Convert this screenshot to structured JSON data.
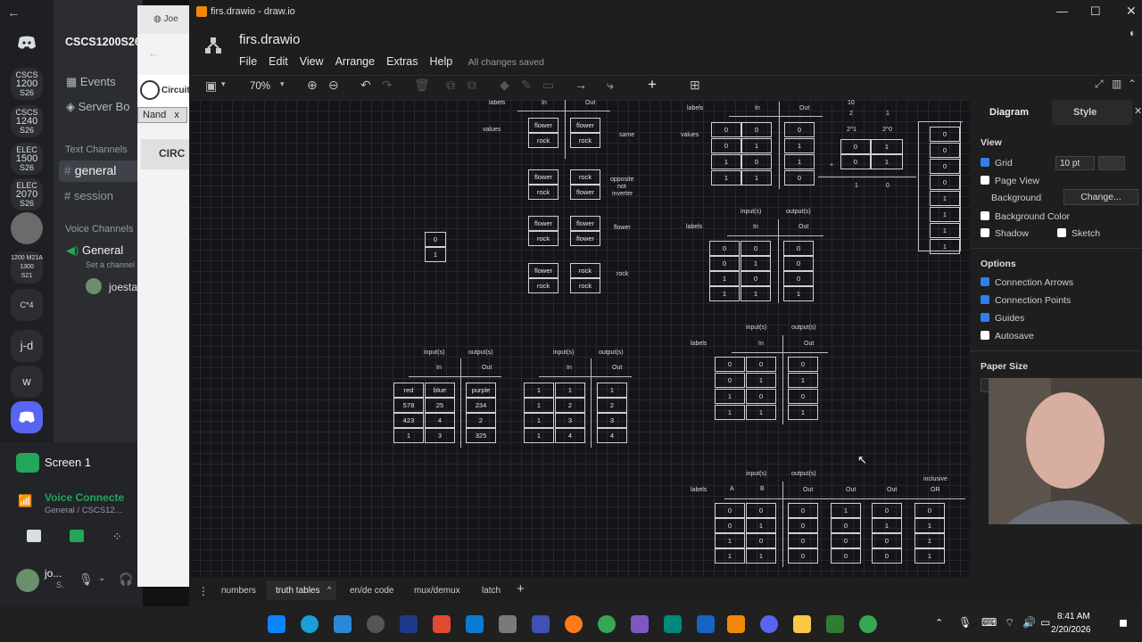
{
  "discord": {
    "nav_back": "←",
    "server_name": "CSCS1200S26",
    "events": "Events",
    "server_boost": "Server Bo",
    "text_channels": "Text Channels",
    "channels": [
      "general",
      "session"
    ],
    "voice_channels": "Voice Channels",
    "voice_general": "General",
    "set_channel": "Set a channel",
    "member": "joesta",
    "servers": [
      {
        "l1": "CSCS",
        "l2": "1200",
        "l3": "S26"
      },
      {
        "l1": "CSCS",
        "l2": "1240",
        "l3": "S26"
      },
      {
        "l1": "ELEC",
        "l2": "1500",
        "l3": "S26"
      },
      {
        "l1": "ELEC",
        "l2": "2070",
        "l3": "S26"
      },
      {
        "l1": "",
        "l2": "",
        "l3": ""
      },
      {
        "l1": "1200 M21A",
        "l2": "1300",
        "l3": "S21"
      },
      {
        "l1": "C*4",
        "l2": "",
        "l3": ""
      },
      {
        "l1": "j-d",
        "l2": "",
        "l3": ""
      },
      {
        "l1": "w",
        "l2": "",
        "l3": ""
      }
    ],
    "screen_share": "Screen 1",
    "voice_connected": "Voice Connecte",
    "voice_sub": "General / CSCS12...",
    "user_short": "jo...",
    "user_sub": "S."
  },
  "browser": {
    "tab": "Joe",
    "site": "Circuit",
    "nand_tag": "Nand",
    "nand_close": "x",
    "circ_label": "CIRC"
  },
  "drawio": {
    "window_title": "firs.drawio - draw.io",
    "file_title": "firs.drawio",
    "menu": [
      "File",
      "Edit",
      "View",
      "Arrange",
      "Extras",
      "Help"
    ],
    "save_status": "All changes saved",
    "zoom": "70%",
    "panel_tabs": {
      "diagram": "Diagram",
      "style": "Style"
    },
    "view_heading": "View",
    "grid_label": "Grid",
    "grid_size": "10 pt",
    "page_view": "Page View",
    "background": "Background",
    "change_btn": "Change...",
    "background_color": "Background Color",
    "shadow": "Shadow",
    "sketch": "Sketch",
    "options_heading": "Options",
    "options": [
      "Connection Arrows",
      "Connection Points",
      "Guides",
      "Autosave"
    ],
    "paper_size": "Paper Size",
    "page_tabs": [
      "numbers",
      "truth tables",
      "en/de code",
      "mux/demux",
      "latch"
    ],
    "add_page": "+"
  },
  "canvas": {
    "t1": {
      "labels": "labels",
      "values": "values",
      "in": "In",
      "out": "Out",
      "rows": [
        [
          "flower",
          "flower"
        ],
        [
          "rock",
          "rock"
        ]
      ],
      "r2": [
        [
          "flower",
          "rock"
        ],
        [
          "rock",
          "flower"
        ]
      ],
      "r3": [
        [
          "flower",
          "flower"
        ],
        [
          "rock",
          "flower"
        ]
      ],
      "r4": [
        [
          "flower",
          "rock"
        ],
        [
          "rock",
          "rock"
        ]
      ],
      "same": "same",
      "opposite": "opposite",
      "not": "not",
      "inverter": "inverter",
      "flower": "flower",
      "rock": "rock"
    },
    "bits": [
      "0",
      "1"
    ],
    "t2": {
      "labels": "labels",
      "values": "values",
      "in": "In",
      "out": "Out",
      "a": [
        "0",
        "0",
        "1",
        "1"
      ],
      "b": [
        "0",
        "1",
        "0",
        "1"
      ],
      "o": [
        "0",
        "1",
        "1",
        "0"
      ]
    },
    "t3": {
      "n10": "10",
      "c2": "2",
      "c1": "1",
      "p1": "2^1",
      "p0": "2^0",
      "rows": [
        [
          "0",
          "1"
        ],
        [
          "0",
          "1"
        ]
      ],
      "plus": "+",
      "s1": "1",
      "s0": "0",
      "col": [
        "0",
        "0",
        "0",
        "0",
        "1",
        "1",
        "1",
        "1"
      ]
    },
    "t4": {
      "inputs": "input(s)",
      "outputs": "output(s)",
      "labels": "labels",
      "in": "In",
      "out": "Out",
      "a": [
        "0",
        "0",
        "1",
        "1"
      ],
      "b": [
        "0",
        "1",
        "0",
        "1"
      ],
      "o": [
        "0",
        "0",
        "0",
        "1"
      ]
    },
    "t5": {
      "inputs": "input(s)",
      "outputs": "output(s)",
      "labels": "labels",
      "in": "In",
      "out": "Out",
      "a": [
        "0",
        "0",
        "1",
        "1"
      ],
      "b": [
        "0",
        "1",
        "0",
        "1"
      ],
      "o": [
        "0",
        "1",
        "0",
        "1"
      ]
    },
    "t6": {
      "inputs": "input(s)",
      "outputs": "output(s)",
      "in": "In",
      "out": "Out",
      "a": [
        "red",
        "578",
        "423",
        "1"
      ],
      "b": [
        "blue",
        "25",
        "4",
        "3"
      ],
      "o": [
        "purple",
        "234",
        "2",
        "325"
      ]
    },
    "t7": {
      "inputs": "input(s)",
      "outputs": "output(s)",
      "in": "In",
      "out": "Out",
      "a": [
        "1",
        "1",
        "1",
        "1"
      ],
      "b": [
        "1",
        "2",
        "3",
        "4"
      ],
      "o": [
        "1",
        "2",
        "3",
        "4"
      ]
    },
    "t8": {
      "inputs": "input(s)",
      "outputs": "output(s)",
      "labels": "labels",
      "A": "A",
      "B": "B",
      "out": "Out",
      "inclusive": "inclusive",
      "or": "OR",
      "a": [
        "0",
        "0",
        "1",
        "1"
      ],
      "b": [
        "0",
        "1",
        "0",
        "1"
      ],
      "o1": [
        "0",
        "0",
        "0",
        "0"
      ],
      "o2": [
        "1",
        "0",
        "0",
        "0"
      ],
      "o3": [
        "0",
        "1",
        "0",
        "0"
      ],
      "o4": [
        "0",
        "1",
        "1",
        "1"
      ]
    }
  },
  "taskbar": {
    "time": "8:41 AM",
    "date": "2/20/2026"
  }
}
